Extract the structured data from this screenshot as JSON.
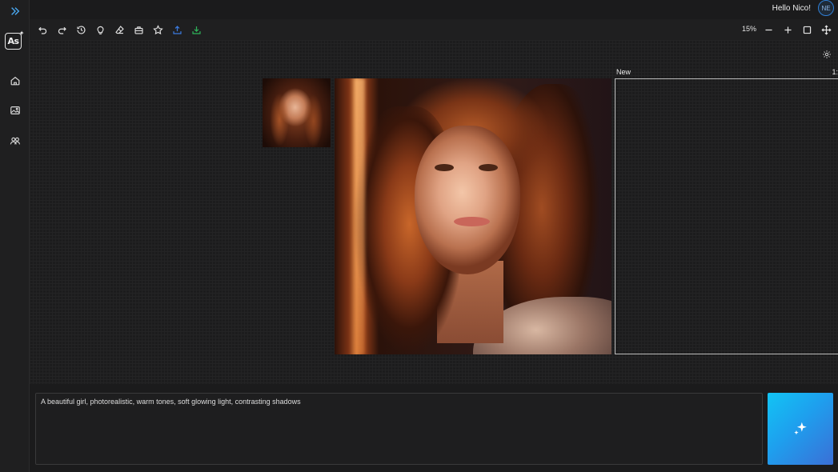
{
  "header": {
    "greeting": "Hello Nico!",
    "avatar_initials": "NE"
  },
  "sidebar": {
    "logo_text": "As",
    "items": [
      {
        "name": "expand",
        "icon": "chevrons-right-icon"
      },
      {
        "name": "home",
        "icon": "home-icon"
      },
      {
        "name": "gallery",
        "icon": "image-icon"
      },
      {
        "name": "community",
        "icon": "users-icon"
      }
    ]
  },
  "toolbar": {
    "tools": [
      "undo",
      "redo",
      "history",
      "idea",
      "eraser",
      "toolbox",
      "favorite",
      "upload",
      "download"
    ],
    "zoom": "15%"
  },
  "canvas": {
    "new_label": "New",
    "new_count": "1:"
  },
  "prompt": {
    "value": "A beautiful girl, photorealistic, warm tones, soft glowing light, contrasting shadows"
  },
  "colors": {
    "accent_blue": "#2f7fd6",
    "upload_icon": "#3b7be0",
    "download_icon": "#2fb35a",
    "generate_gradient_start": "#12c4f4",
    "generate_gradient_end": "#3b6fd6"
  }
}
